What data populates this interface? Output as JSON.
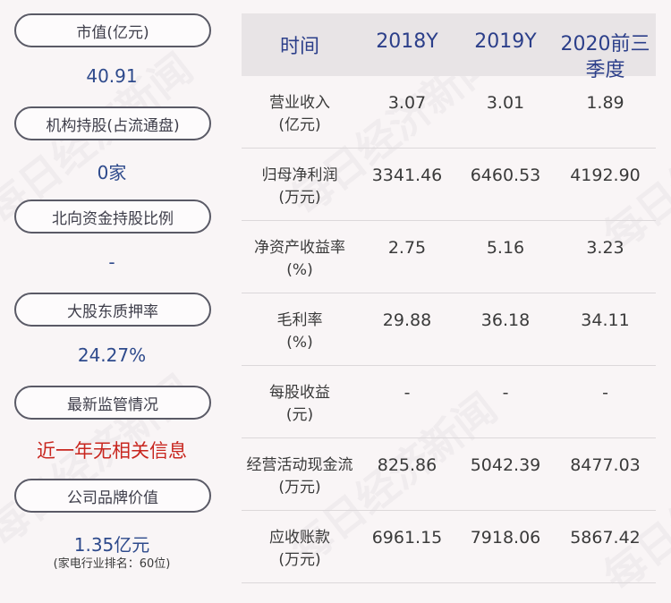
{
  "left_panel": {
    "items": [
      {
        "label": "市值(亿元)",
        "value": "40.91"
      },
      {
        "label": "机构持股(占流通盘)",
        "value": "0家"
      },
      {
        "label": "北向资金持股比例",
        "value": "-"
      },
      {
        "label": "大股东质押率",
        "value": "24.27%"
      },
      {
        "label": "最新监管情况",
        "value": "近一年无相关信息"
      },
      {
        "label": "公司品牌价值",
        "value": "1.35亿元",
        "note": "(家电行业排名：60位)"
      }
    ],
    "colors": {
      "value": "#2e4a8c",
      "alert": "#c8261f"
    }
  },
  "table": {
    "headers": [
      "时间",
      "2018Y",
      "2019Y",
      "2020前三季度"
    ],
    "rows": [
      {
        "label": [
          "营业收入",
          "(亿元)"
        ],
        "values": [
          "3.07",
          "3.01",
          "1.89"
        ]
      },
      {
        "label": [
          "归母净利润",
          "(万元)"
        ],
        "values": [
          "3341.46",
          "6460.53",
          "4192.90"
        ]
      },
      {
        "label": [
          "净资产收益率",
          "(%)"
        ],
        "values": [
          "2.75",
          "5.16",
          "3.23"
        ]
      },
      {
        "label": [
          "毛利率",
          "(%)"
        ],
        "values": [
          "29.88",
          "36.18",
          "34.11"
        ]
      },
      {
        "label": [
          "每股收益",
          "(元)"
        ],
        "values": [
          "-",
          "-",
          "-"
        ]
      },
      {
        "label": [
          "经营活动现金流",
          "(万元)"
        ],
        "values": [
          "825.86",
          "5042.39",
          "8477.03"
        ]
      },
      {
        "label": [
          "应收账款",
          "(万元)"
        ],
        "values": [
          "6961.15",
          "7918.06",
          "5867.42"
        ]
      }
    ]
  },
  "watermark": "每日经济新闻"
}
